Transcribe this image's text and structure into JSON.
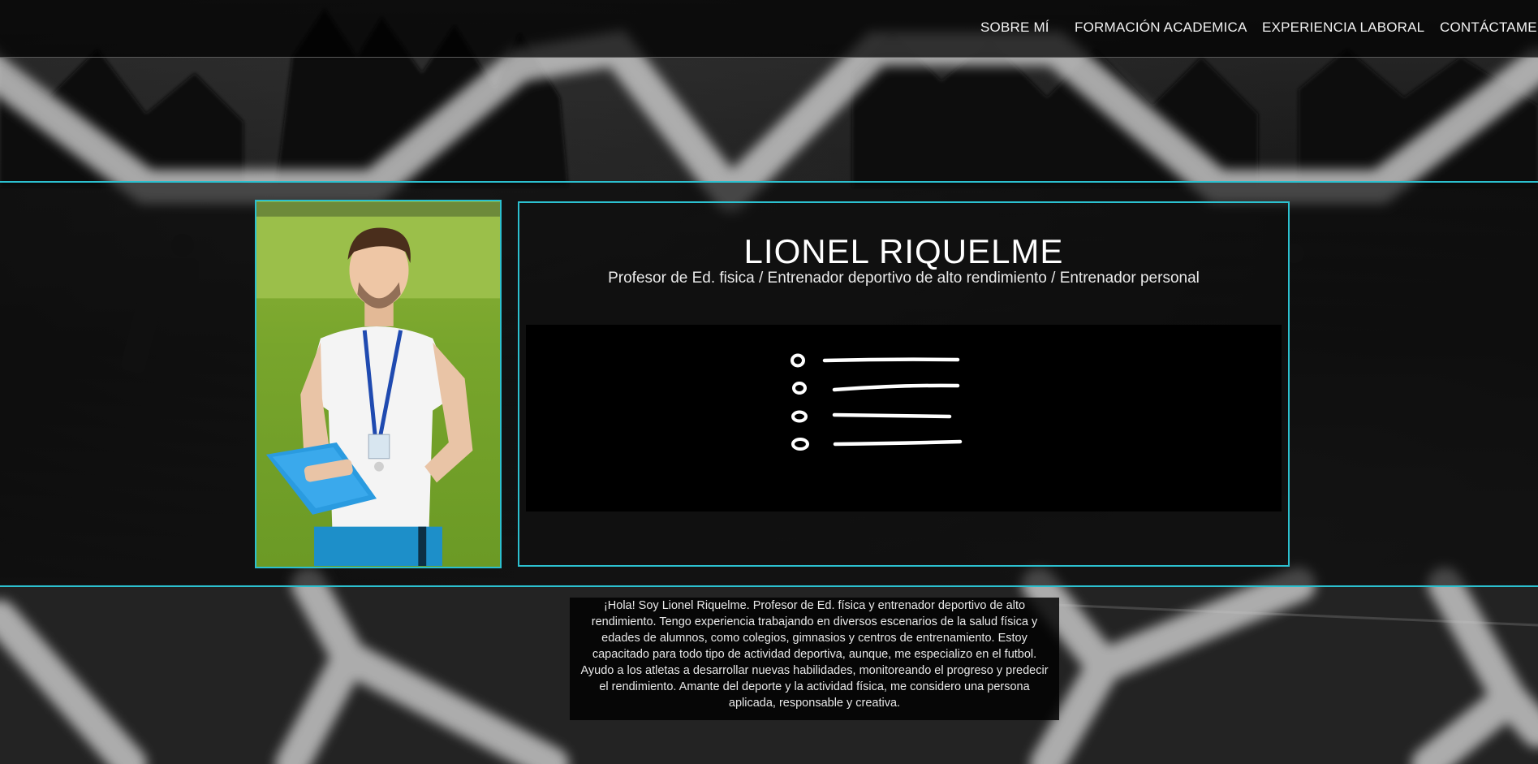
{
  "nav": {
    "items": [
      {
        "label": "SOBRE MÍ"
      },
      {
        "label": "FORMACIÓN ACADEMICA"
      },
      {
        "label": "EXPERIENCIA LABORAL"
      },
      {
        "label": "CONTÁCTAME"
      }
    ]
  },
  "profile": {
    "name": "LIONEL RIQUELME",
    "subtitle": "Profesor de Ed. fisica / Entrenador deportivo de alto rendimiento / Entrenador personal"
  },
  "skills_list": {
    "item_count": 4
  },
  "bio": {
    "text": "¡Hola! Soy Lionel Riquelme. Profesor de Ed. física y entrenador deportivo de alto rendimiento. Tengo experiencia trabajando en diversos escenarios de la salud física y edades de alumnos, como colegios, gimnasios y centros de entrenamiento. Estoy capacitado para todo tipo de actividad deportiva, aunque, me especializo en el futbol. Ayudo a los atletas a desarrollar nuevas habilidades, monitoreando el progreso y predecir el rendimiento. Amante del deporte y la actividad física, me considero una persona aplicada, responsable y creativa."
  },
  "colors": {
    "accent": "#2cc0cf",
    "nav_bg": "#000000",
    "panel_bg": "#000000"
  }
}
